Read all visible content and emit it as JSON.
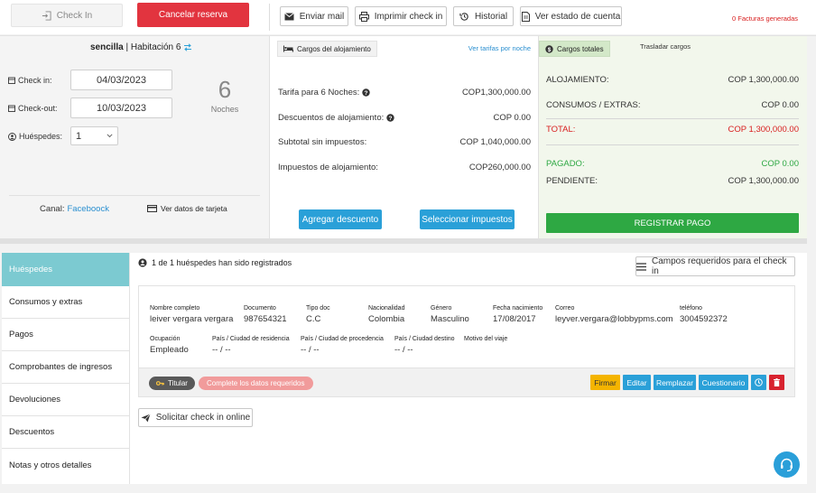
{
  "toolbar": {
    "check_in": "Check In",
    "cancel": "Cancelar reserva",
    "send_mail": "Enviar mail",
    "print_checkin": "Imprimir check in",
    "history": "Historial",
    "account_status": "Ver estado de cuenta",
    "invoices": "0 Facturas generadas"
  },
  "room": {
    "type": "sencilla",
    "separator": " | ",
    "room": "Habitación 6"
  },
  "stay": {
    "checkin_label": "Check in:",
    "checkin_value": "04/03/2023",
    "checkout_label": "Check-out:",
    "checkout_value": "10/03/2023",
    "guests_label": "Huéspedes:",
    "guests_value": "1",
    "nights_count": "6",
    "nights_label": "Noches",
    "channel_label": "Canal:",
    "channel_value": "Faceboock",
    "card_link": "Ver datos de tarjeta"
  },
  "charges": {
    "title": "Cargos del alojamiento",
    "rates_link": "Ver tarifas por noche",
    "rows": [
      {
        "label": "Tarifa para 6 Noches:",
        "value": "COP1,300,000.00"
      },
      {
        "label": "Descuentos de alojamiento:",
        "value": "COP 0.00"
      },
      {
        "label": "Subtotal sin impuestos:",
        "value": "COP 1,040,000.00"
      },
      {
        "label": "Impuestos de alojamiento:",
        "value": "COP260,000.00"
      }
    ],
    "add_discount": "Agregar descuento",
    "select_taxes": "Seleccionar impuestos"
  },
  "totals": {
    "tab_total": "Cargos totales",
    "tab_transfer": "Trasladar cargos",
    "lodging_label": "ALOJAMIENTO:",
    "lodging_value": "COP 1,300,000.00",
    "extras_label": "CONSUMOS / EXTRAS:",
    "extras_value": "COP 0.00",
    "total_label": "TOTAL:",
    "total_value": "COP 1,300,000.00",
    "paid_label": "PAGADO:",
    "paid_value": "COP 0.00",
    "pending_label": "PENDIENTE:",
    "pending_value": "COP 1,300,000.00",
    "register_payment": "REGISTRAR PAGO"
  },
  "sidebar": {
    "items": [
      "Huéspedes",
      "Consumos y extras",
      "Pagos",
      "Comprobantes de ingresos",
      "Devoluciones",
      "Descuentos",
      "Notas y otros detalles"
    ]
  },
  "guests": {
    "registered": "1 de 1 huéspedes han sido registrados",
    "required_fields": "Campos requeridos para el check in",
    "labels": {
      "name": "Nombre completo",
      "doc": "Documento",
      "doc_type": "Tipo doc",
      "nationality": "Nacionalidad",
      "gender": "Género",
      "birth": "Fecha nacimiento",
      "email": "Correo",
      "phone": "teléfono",
      "occupation": "Ocupación",
      "residence": "País / Ciudad de residencia",
      "origin": "País / Ciudad de procedencia",
      "destination": "País / Ciudad destino",
      "reason": "Motivo del viaje"
    },
    "values": {
      "name": "leiver vergara vergara",
      "doc": "987654321",
      "doc_type": "C.C",
      "nationality": "Colombia",
      "gender": "Masculino",
      "birth": "17/08/2017",
      "email": "leyver.vergara@lobbypms.com",
      "phone": "3004592372",
      "occupation": "Empleado",
      "residence": "-- / --",
      "origin": "-- / --",
      "destination": "-- / --"
    },
    "holder_badge": "Titular",
    "complete_badge": "Complete los datos requeridos",
    "sign": "Firmar",
    "edit": "Editar",
    "replace": "Remplazar",
    "questionnaire": "Cuestionario",
    "online_checkin": "Solicitar check in online"
  },
  "colors": {
    "cancel": "#e2343f",
    "accent_blue": "#2aa0d8",
    "green": "#2ea843",
    "red_text": "#d81f1f",
    "sidebar_active": "#7ccad1",
    "sign_yellow": "#f4b400"
  }
}
